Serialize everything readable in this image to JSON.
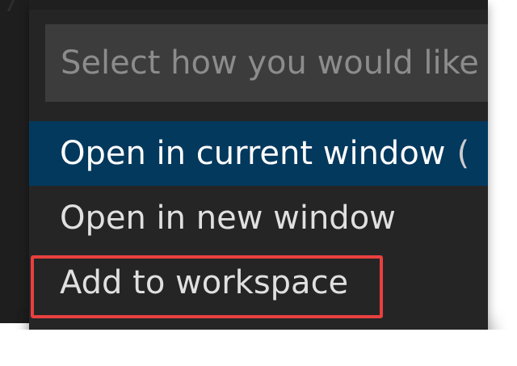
{
  "quick_pick": {
    "placeholder": "Select how you would like",
    "items": [
      {
        "label": "Open in current window",
        "hint": "(",
        "selected": true
      },
      {
        "label": "Open in new window",
        "hint": "",
        "selected": false
      },
      {
        "label": "Add to workspace",
        "hint": "",
        "selected": false
      }
    ]
  },
  "colors": {
    "popup_background": "#252526",
    "input_background": "#3c3c3c",
    "selected_background": "#04395e",
    "annotation_border": "#e8403f"
  }
}
